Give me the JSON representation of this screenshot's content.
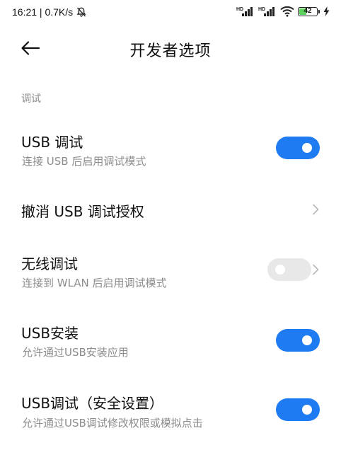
{
  "status_bar": {
    "time_speed": "16:21 | 0.7K/s",
    "battery_level": "42",
    "battery_fraction": 0.42,
    "network_labels": [
      "HD",
      "HD"
    ]
  },
  "header": {
    "title": "开发者选项"
  },
  "section": {
    "label": "调试"
  },
  "items": [
    {
      "title": "USB 调试",
      "subtitle": "连接 USB 后启用调试模式",
      "toggle": "on"
    },
    {
      "title": "撤消 USB 调试授权",
      "subtitle": "",
      "toggle": "none"
    },
    {
      "title": "无线调试",
      "subtitle": "连接到 WLAN 后启用调试模式",
      "toggle": "disabled"
    },
    {
      "title": "USB安装",
      "subtitle": "允许通过USB安装应用",
      "toggle": "on"
    },
    {
      "title": "USB调试（安全设置）",
      "subtitle": "允许通过USB调试修改权限或模拟点击",
      "toggle": "on"
    }
  ],
  "colors": {
    "accent": "#1f7bf2",
    "toggle_disabled": "#e8e8e8",
    "secondary_text": "#8c8c8c"
  },
  "icons": [
    "bell-off-icon",
    "signal-icon",
    "wifi-icon",
    "battery-icon",
    "charging-icon",
    "back-arrow-icon",
    "chevron-right-icon"
  ]
}
